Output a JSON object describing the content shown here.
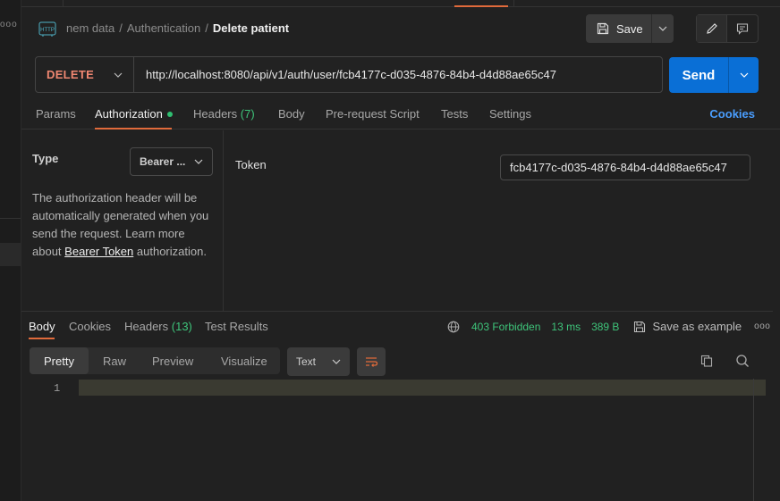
{
  "sidebar": {
    "dots": "ooo"
  },
  "breadcrumb": {
    "icon": "http-icon",
    "collection": "nem data",
    "folder": "Authentication",
    "request": "Delete patient",
    "separator": "/"
  },
  "toolbar": {
    "save_label": "Save",
    "icons": [
      "save-icon",
      "chevron-down-icon",
      "pencil-icon",
      "comment-icon"
    ]
  },
  "request": {
    "method": "DELETE",
    "url": "http://localhost:8080/api/v1/auth/user/fcb4177c-d035-4876-84b4-d4d88ae65c47",
    "send_label": "Send"
  },
  "request_tabs": [
    {
      "label": "Params"
    },
    {
      "label": "Authorization",
      "active": true,
      "has_dot": true
    },
    {
      "label": "Headers",
      "count": "(7)"
    },
    {
      "label": "Body"
    },
    {
      "label": "Pre-request Script"
    },
    {
      "label": "Tests"
    },
    {
      "label": "Settings"
    }
  ],
  "cookies_link": "Cookies",
  "auth": {
    "type_label": "Type",
    "type_value": "Bearer ...",
    "desc_part1": "The authorization header will be automatically generated when you send the request. Learn more about",
    "desc_link": "Bearer Token",
    "desc_part2": "authorization.",
    "token_label": "Token",
    "token_value": "fcb4177c-d035-4876-84b4-d4d88ae65c47"
  },
  "response_tabs": [
    {
      "label": "Body",
      "active": true
    },
    {
      "label": "Cookies"
    },
    {
      "label": "Headers",
      "count": "(13)"
    },
    {
      "label": "Test Results"
    }
  ],
  "response_status": {
    "status": "403 Forbidden",
    "time": "13 ms",
    "size": "389 B",
    "save_example": "Save as example",
    "more": "ooo"
  },
  "view_modes": [
    "Pretty",
    "Raw",
    "Preview",
    "Visualize"
  ],
  "format_select": "Text",
  "editor": {
    "line_number": "1"
  },
  "colors": {
    "accent": "#e06a3b",
    "send": "#0a6fd6",
    "method": "#f08771",
    "success": "#3ec47a",
    "link": "#4a9eff"
  }
}
